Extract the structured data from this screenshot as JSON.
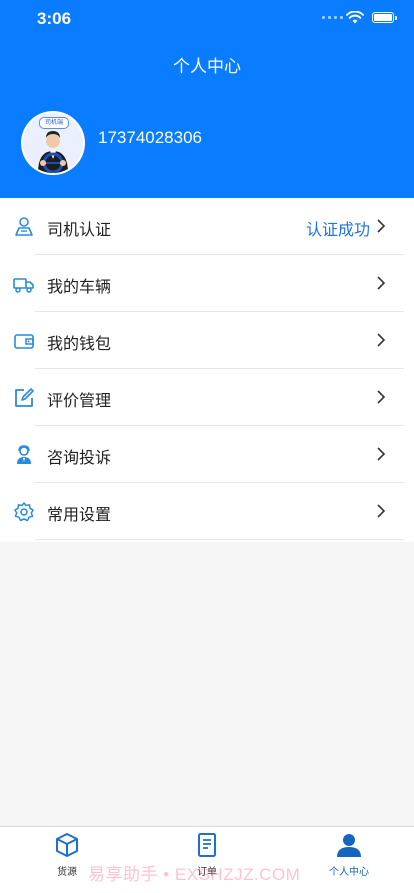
{
  "status_bar": {
    "time": "3:06"
  },
  "header": {
    "title": "个人中心"
  },
  "profile": {
    "avatar_tag": "司机端",
    "phone": "17374028306"
  },
  "menu": [
    {
      "label": "司机认证",
      "value": "认证成功",
      "icon": "person-id-icon"
    },
    {
      "label": "我的车辆",
      "icon": "truck-icon"
    },
    {
      "label": "我的钱包",
      "icon": "wallet-icon"
    },
    {
      "label": "评价管理",
      "icon": "edit-icon"
    },
    {
      "label": "咨询投诉",
      "icon": "service-agent-icon"
    },
    {
      "label": "常用设置",
      "icon": "gear-icon"
    }
  ],
  "tabbar": [
    {
      "label": "货源",
      "icon": "cube-icon"
    },
    {
      "label": "订单",
      "icon": "document-icon"
    },
    {
      "label": "个人中心",
      "icon": "person-icon",
      "active": true
    }
  ],
  "watermark": "易享助手 • EXSHZJZ.COM",
  "colors": {
    "primary": "#0a7cff",
    "accent_text": "#1a73e8",
    "icon": "#2a8bd8",
    "tab_active": "#1565c0"
  }
}
